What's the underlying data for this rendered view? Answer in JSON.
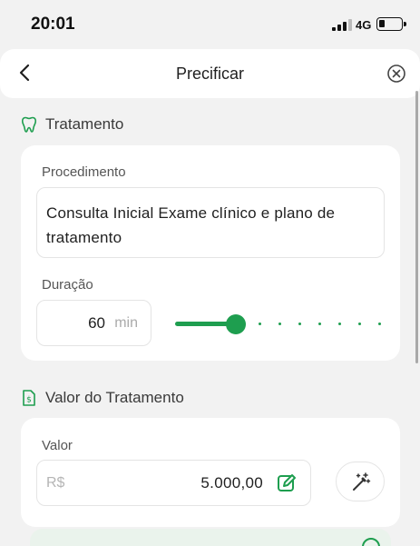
{
  "status_bar": {
    "time": "20:01",
    "network": "4G"
  },
  "header": {
    "title": "Precificar",
    "back_icon": "chevron-left-icon",
    "close_icon": "close-circle-icon"
  },
  "sections": {
    "treatment": {
      "title": "Tratamento",
      "icon": "tooth-icon"
    },
    "value": {
      "title": "Valor do Tratamento",
      "icon": "money-document-icon"
    }
  },
  "procedure": {
    "label": "Procedimento",
    "value": "Consulta Inicial Exame clínico e plano de tratamento"
  },
  "duration": {
    "label": "Duração",
    "value": "60",
    "unit": "min",
    "slider_fraction": 0.3
  },
  "price": {
    "label": "Valor",
    "currency": "R$",
    "amount": "5.000,00",
    "edit_icon": "edit-icon",
    "magic_icon": "magic-wand-icon"
  },
  "colors": {
    "accent": "#1e9e4f",
    "background": "#f2f2f2",
    "card": "#ffffff"
  }
}
